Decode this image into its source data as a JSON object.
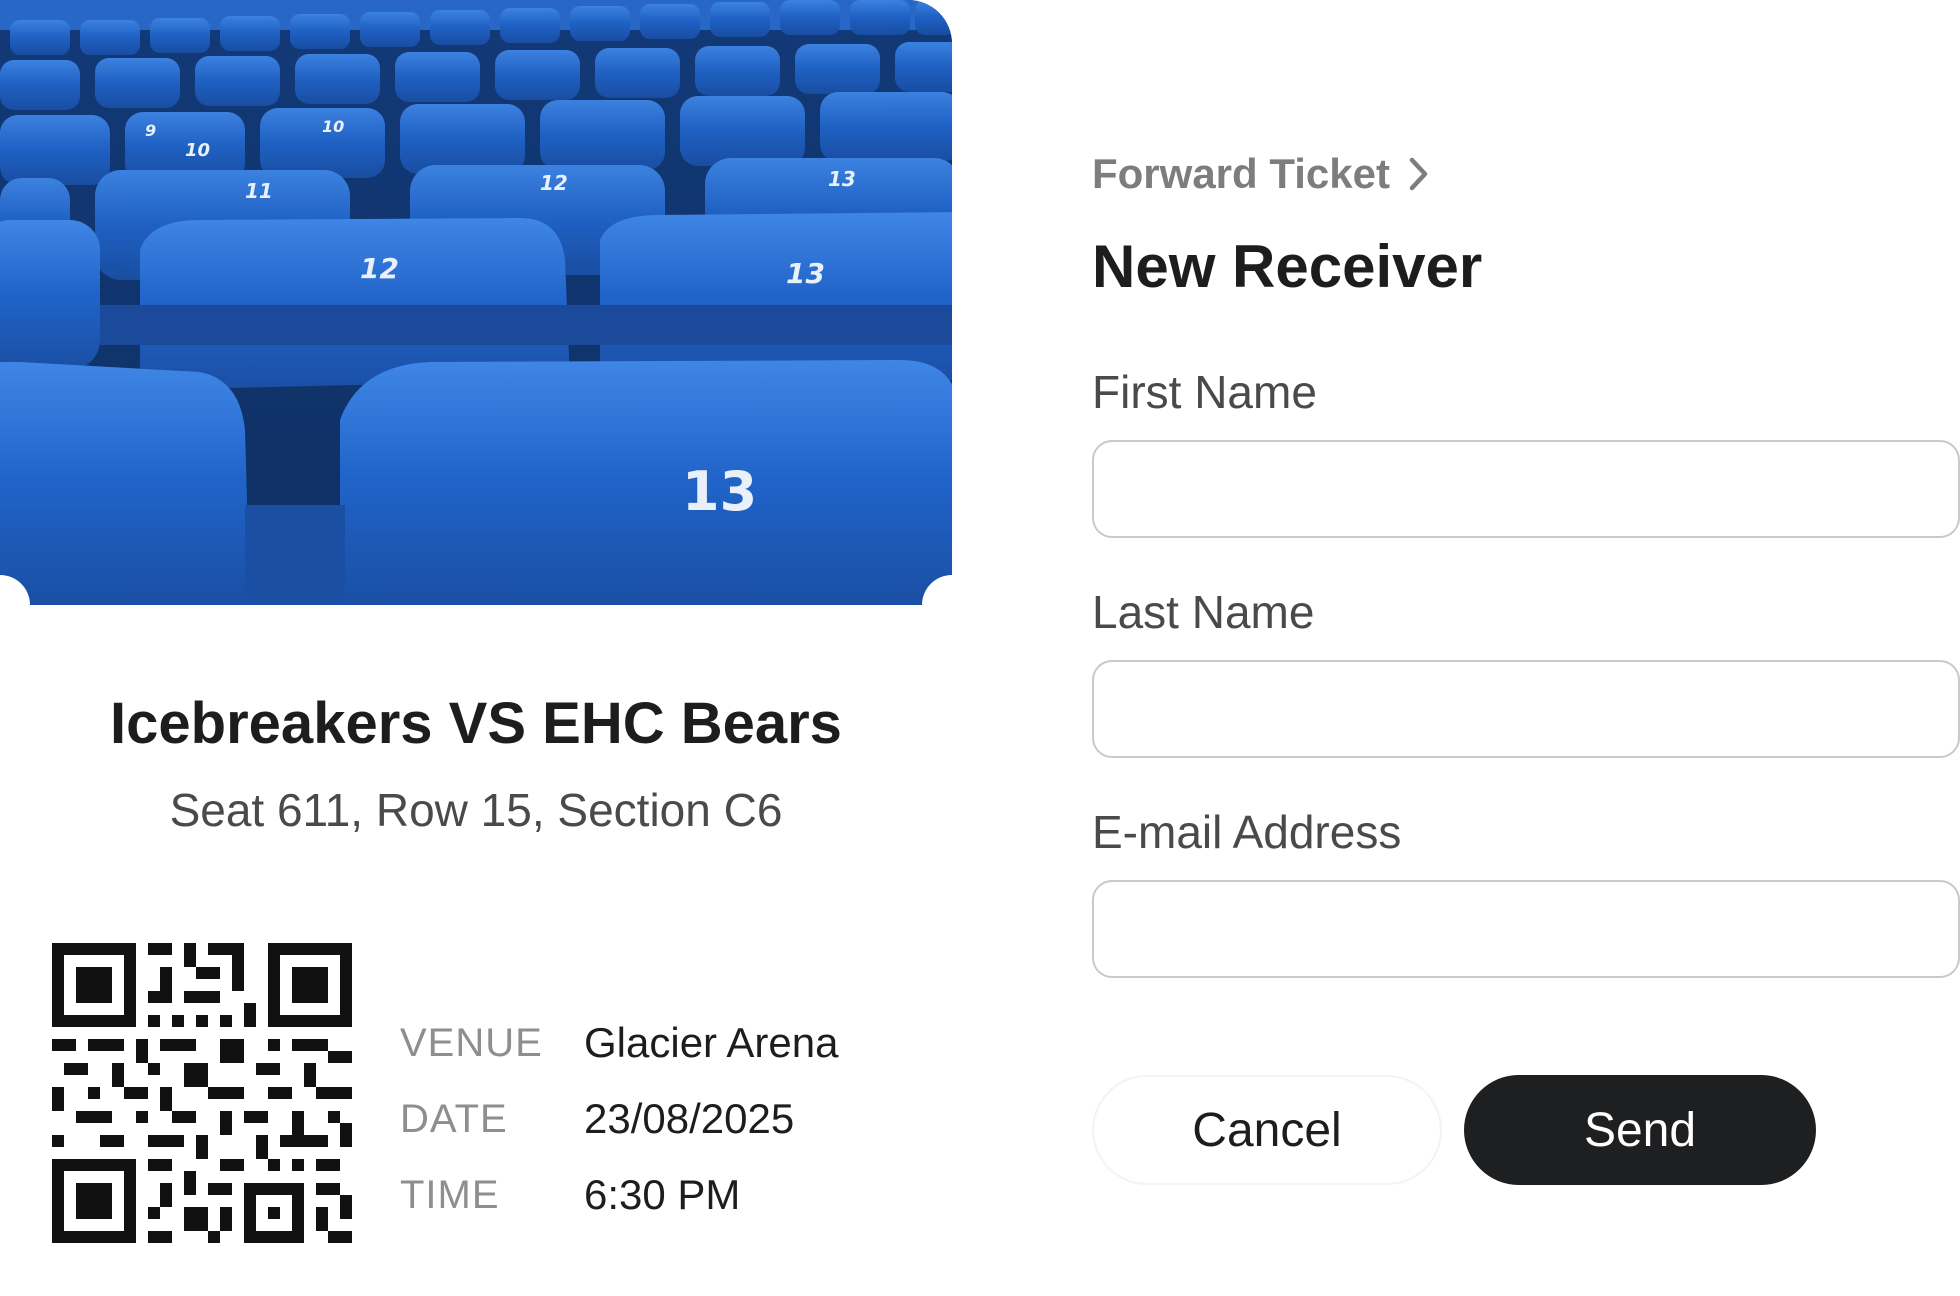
{
  "ticket": {
    "event_title": "Icebreakers VS EHC Bears",
    "seat_info": "Seat 611, Row 15, Section C6",
    "seat_numbers_visible": [
      "9",
      "10",
      "11",
      "12",
      "13"
    ],
    "details": [
      {
        "label": "VENUE",
        "value": "Glacier Arena"
      },
      {
        "label": "DATE",
        "value": "23/08/2025"
      },
      {
        "label": "TIME",
        "value": "6:30 PM"
      }
    ]
  },
  "form": {
    "breadcrumb": "Forward Ticket",
    "title": "New Receiver",
    "fields": [
      {
        "label": "First Name",
        "value": "",
        "placeholder": ""
      },
      {
        "label": "Last Name",
        "value": "",
        "placeholder": ""
      },
      {
        "label": "E-mail Address",
        "value": "",
        "placeholder": ""
      }
    ],
    "cancel_label": "Cancel",
    "send_label": "Send"
  },
  "colors": {
    "seat_blue": "#1f5fc0",
    "primary_button": "#1e1f21",
    "label_grey": "#8e8e8e",
    "border": "#c9c9c9"
  },
  "icons": {
    "breadcrumb": "chevron-right-icon"
  }
}
